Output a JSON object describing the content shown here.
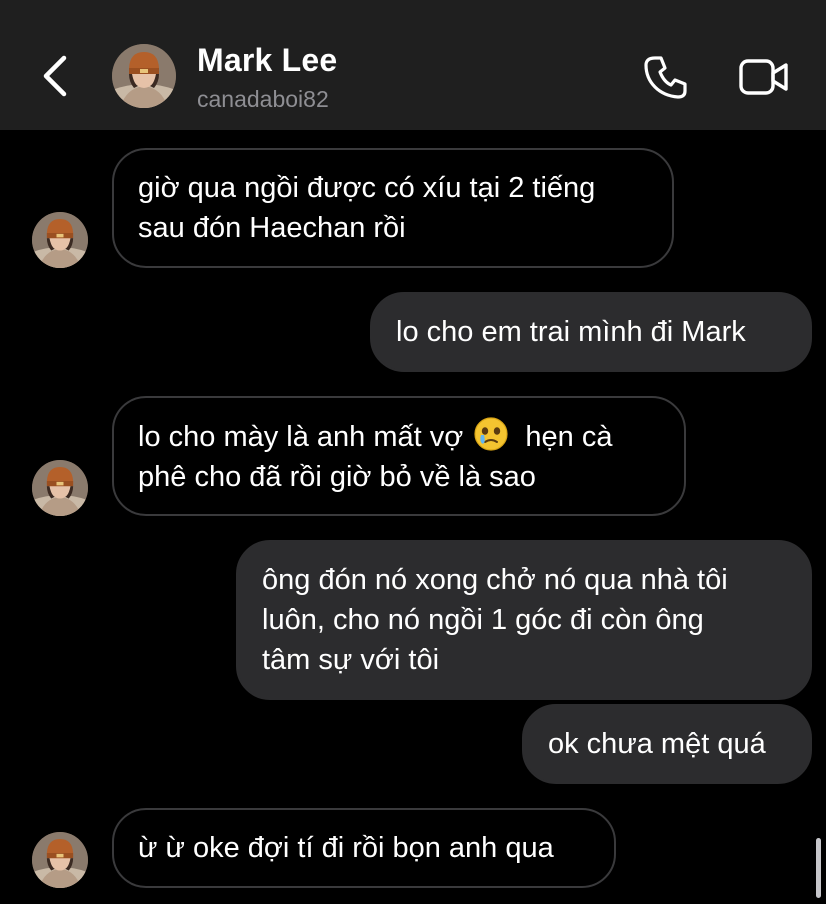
{
  "header": {
    "name": "Mark Lee",
    "username": "canadaboi82",
    "back_icon": "chevron-left-icon",
    "call_icon": "phone-icon",
    "video_icon": "video-camera-icon"
  },
  "colors": {
    "background": "#000000",
    "header_bg": "#1f1f1f",
    "outgoing_bubble": "#2c2c2e",
    "incoming_border": "#3a3a3c",
    "secondary_text": "#8e8e93"
  },
  "messages": [
    {
      "direction": "incoming",
      "lines": [
        "giờ qua ngồi được có xíu tại 2 tiếng",
        "sau đón Haechan rồi"
      ]
    },
    {
      "direction": "outgoing",
      "lines": [
        "lo cho em trai mình đi Mark"
      ]
    },
    {
      "direction": "incoming",
      "lines": [
        "lo cho mày là anh mất vợ",
        "hẹn cà",
        "phê cho đã rồi giờ bỏ về là sao"
      ],
      "emoji": "face-holding-back-tears-emoji"
    },
    {
      "direction": "outgoing",
      "lines": [
        "ông đón nó xong chở nó qua nhà tôi",
        "luôn, cho nó ngồi 1 góc đi còn ông",
        "tâm sự với tôi"
      ]
    },
    {
      "direction": "outgoing",
      "lines": [
        "ok chưa mệt quá"
      ]
    },
    {
      "direction": "incoming",
      "lines": [
        "ừ ừ oke đợi tí đi rồi bọn anh qua"
      ]
    }
  ]
}
